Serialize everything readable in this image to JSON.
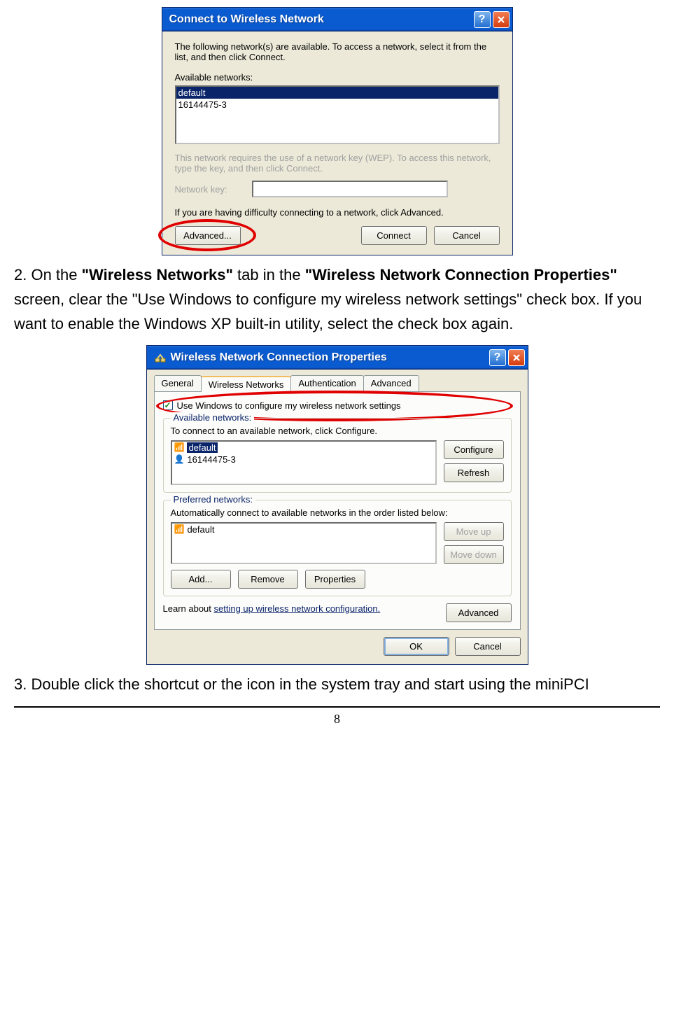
{
  "dialog1": {
    "title": "Connect to Wireless Network",
    "intro": "The following network(s) are available. To access a network, select it from the list, and then click Connect.",
    "available_label": "Available networks:",
    "networks": [
      "default",
      "16144475-3"
    ],
    "wep_note": "This network requires the use of a network key (WEP). To access this network, type the key, and then click Connect.",
    "key_label": "Network key:",
    "help_note": "If you are having difficulty connecting to a network, click Advanced.",
    "advanced_btn": "Advanced...",
    "connect_btn": "Connect",
    "cancel_btn": "Cancel"
  },
  "instruction2": {
    "prefix": "2. On the ",
    "bold1": "\"Wireless Networks\"",
    "mid1": " tab in the ",
    "bold2": "\"Wireless Network Connection Properties\"",
    "rest": " screen, clear the \"Use Windows to configure my wireless network settings\" check box. If you want to enable the Windows XP built-in utility, select the check box again."
  },
  "dialog2": {
    "title": "Wireless Network Connection Properties",
    "tabs": [
      "General",
      "Wireless Networks",
      "Authentication",
      "Advanced"
    ],
    "active_tab": 1,
    "checkbox_label": "Use Windows to configure my wireless network settings",
    "available": {
      "legend": "Available networks:",
      "hint": "To connect to an available network, click Configure.",
      "items": [
        "default",
        "16144475-3"
      ],
      "configure_btn": "Configure",
      "refresh_btn": "Refresh"
    },
    "preferred": {
      "legend": "Preferred networks:",
      "hint": "Automatically connect to available networks in the order listed below:",
      "items": [
        "default"
      ],
      "moveup_btn": "Move up",
      "movedown_btn": "Move down",
      "add_btn": "Add...",
      "remove_btn": "Remove",
      "properties_btn": "Properties"
    },
    "learn_prefix": "Learn about ",
    "learn_link": "setting up wireless network configuration.",
    "advanced_btn": "Advanced",
    "ok_btn": "OK",
    "cancel_btn": "Cancel"
  },
  "instruction3": "3. Double click the shortcut or the icon in the system tray and start using the miniPCI",
  "page_number": "8"
}
